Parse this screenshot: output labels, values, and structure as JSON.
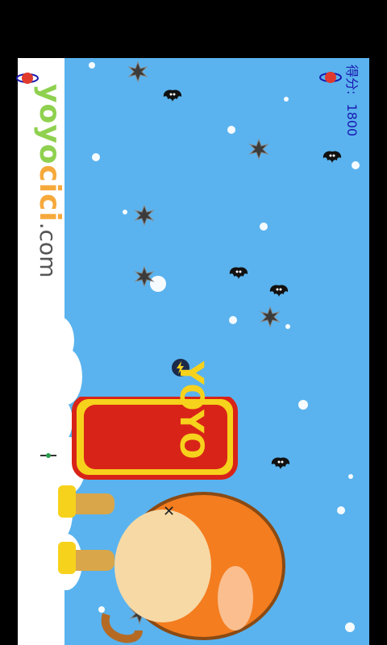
{
  "hud": {
    "score_label": "得分:",
    "score_value": "1800"
  },
  "logo": {
    "part1": "yoyo",
    "part2": "cici",
    "part3": ".com"
  },
  "banner": {
    "text": "YOYO"
  },
  "icons": {
    "score_icon": "planet-ring-icon",
    "enemy": "spiky-mine-icon",
    "bat": "black-bat-icon",
    "coin": "lightning-coin-icon"
  },
  "colors": {
    "sky": "#5ab3ee",
    "score_text": "#1a1ab0",
    "banner_red": "#d82418",
    "banner_yellow": "#f7d21c",
    "monkey_orange": "#f47d1f"
  }
}
